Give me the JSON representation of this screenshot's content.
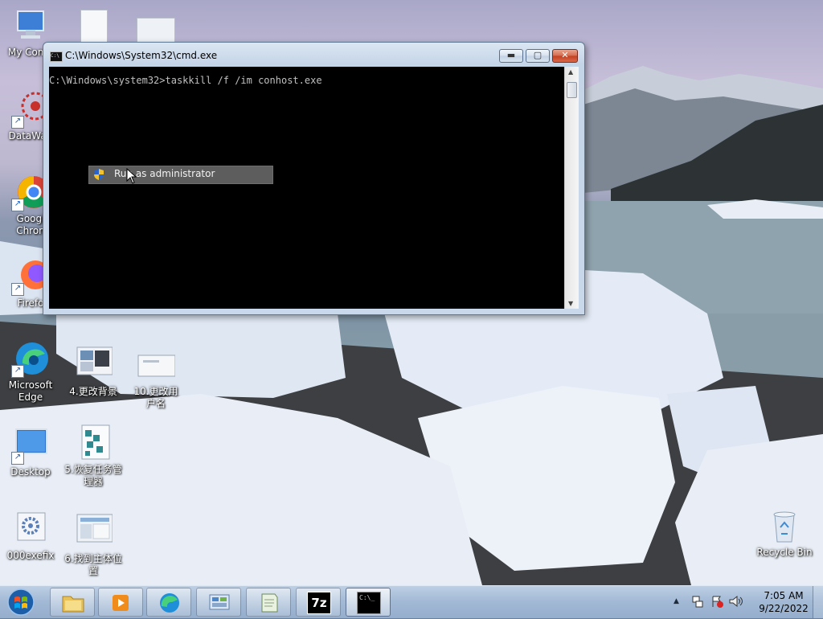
{
  "desktop": {
    "icons": [
      {
        "label": "My Comp"
      },
      {
        "label": "DataWag"
      },
      {
        "label": "Googl Chron"
      },
      {
        "label": "Firefo"
      },
      {
        "label": "Microsoft Edge"
      },
      {
        "label": "Desktop"
      },
      {
        "label": "000exefix"
      },
      {
        "label": "4.更改背景"
      },
      {
        "label": "10.更改用户名"
      },
      {
        "label": "5.恢复任务管理器"
      },
      {
        "label": "6.找到主体位置"
      },
      {
        "label": "Recycle Bin"
      }
    ]
  },
  "cmd_window": {
    "title": "C:\\Windows\\System32\\cmd.exe",
    "icon_text": "C:\\",
    "min_glyph": "▬",
    "max_glyph": "▢",
    "close_glyph": "✕",
    "console_text": "C:\\Windows\\system32>taskkill /f /im conhost.exe",
    "scroll_up": "▲",
    "scroll_down": "▼"
  },
  "drag_ghost": {
    "label": "Run as administrator"
  },
  "taskbar": {
    "seven_zip_label": "7z",
    "cmd_label": "C:\\_",
    "tray_up_arrow": "▲",
    "clock_time": "7:05 AM",
    "clock_date": "9/22/2022"
  }
}
